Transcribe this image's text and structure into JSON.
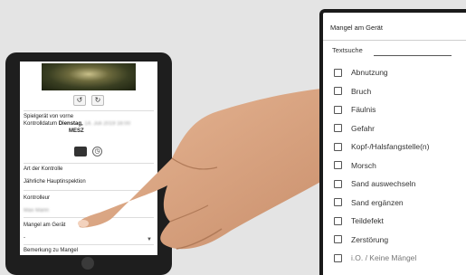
{
  "tablet": {
    "spielgeraet_label": "Spielgerät von vorne",
    "kontrolldatum_label": "Kontrolldatum",
    "kontrolldatum_day": "Dienstag,",
    "kontrolldatum_blur": "14. Juli 2019 16:00",
    "kontrolldatum_tz": "MESZ",
    "art_label": "Art der Kontrolle",
    "art_value": "Jährliche Hauptinspektion",
    "kontrolleur_label": "Kontrolleur",
    "kontrolleur_blur": "Max Mann",
    "mangel_label": "Mangel am Gerät",
    "mangel_value": "-",
    "bemerkung_label": "Bemerkung zu Mangel"
  },
  "panel": {
    "title": "Mangel am Gerät",
    "search_label": "Textsuche",
    "search_value": "",
    "items": [
      {
        "label": "Abnutzung"
      },
      {
        "label": "Bruch"
      },
      {
        "label": "Fäulnis"
      },
      {
        "label": "Gefahr"
      },
      {
        "label": "Kopf-/Halsfangstelle(n)"
      },
      {
        "label": "Morsch"
      },
      {
        "label": "Sand auswechseln"
      },
      {
        "label": "Sand ergänzen"
      },
      {
        "label": "Teildefekt"
      },
      {
        "label": "Zerstörung"
      },
      {
        "label": "i.O. / Keine Mängel"
      }
    ]
  }
}
